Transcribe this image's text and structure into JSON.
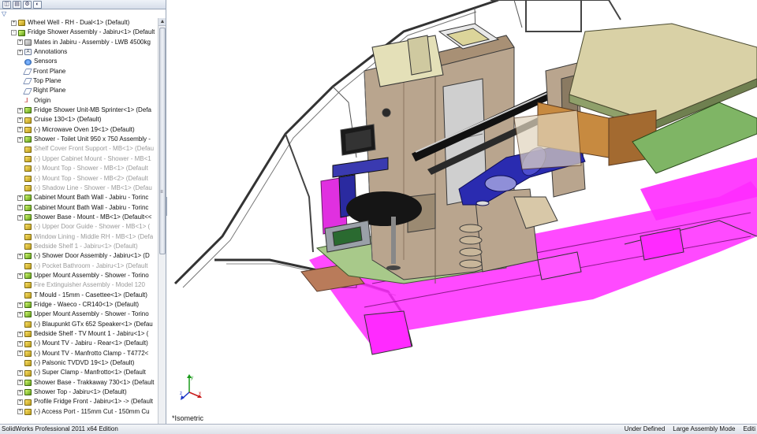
{
  "tree": {
    "filter_glyph": "▽",
    "tabs": [
      "feature-manager",
      "property-manager",
      "configuration-manager",
      "appearance-manager"
    ],
    "items": [
      {
        "label": "Wheel Well - RH - Dual<1> (Default)",
        "indent": 1,
        "expander": "+",
        "icon": "part",
        "suppressed": false
      },
      {
        "label": "Fridge Shower Assembly - Jabiru<1> (Default",
        "indent": 1,
        "expander": "-",
        "icon": "asm",
        "suppressed": false
      },
      {
        "label": "Mates in Jabiru - Assembly - LWB 4500kg",
        "indent": 2,
        "expander": "+",
        "icon": "mates",
        "suppressed": false
      },
      {
        "label": "Annotations",
        "indent": 2,
        "expander": "+",
        "icon": "annot",
        "suppressed": false
      },
      {
        "label": "Sensors",
        "indent": 2,
        "expander": "",
        "icon": "sensor",
        "suppressed": false
      },
      {
        "label": "Front Plane",
        "indent": 2,
        "expander": "",
        "icon": "plane",
        "suppressed": false
      },
      {
        "label": "Top Plane",
        "indent": 2,
        "expander": "",
        "icon": "plane",
        "suppressed": false
      },
      {
        "label": "Right Plane",
        "indent": 2,
        "expander": "",
        "icon": "plane",
        "suppressed": false
      },
      {
        "label": "Origin",
        "indent": 2,
        "expander": "",
        "icon": "origin",
        "suppressed": false
      },
      {
        "label": "Fridge Shower Unit-MB Sprinter<1> (Defa",
        "indent": 2,
        "expander": "+",
        "icon": "asm",
        "suppressed": false
      },
      {
        "label": "Cruise 130<1> (Default)",
        "indent": 2,
        "expander": "+",
        "icon": "part",
        "suppressed": false
      },
      {
        "label": "(-) Microwave Oven 19<1> (Default)",
        "indent": 2,
        "expander": "+",
        "icon": "part",
        "suppressed": false
      },
      {
        "label": "Shower - Toilet Unit 950 x 750 Assembly -",
        "indent": 2,
        "expander": "+",
        "icon": "asm",
        "suppressed": false
      },
      {
        "label": "Shelf Cover Front Support - MB<1> (Defau",
        "indent": 2,
        "expander": "",
        "icon": "part",
        "suppressed": true
      },
      {
        "label": "(-) Upper Cabinet Mount - Shower - MB<1",
        "indent": 2,
        "expander": "",
        "icon": "part",
        "suppressed": true
      },
      {
        "label": "(-) Mount Top - Shower - MB<1> (Default",
        "indent": 2,
        "expander": "",
        "icon": "part",
        "suppressed": true
      },
      {
        "label": "(-) Mount Top - Shower - MB<2> (Default",
        "indent": 2,
        "expander": "",
        "icon": "part",
        "suppressed": true
      },
      {
        "label": "(-) Shadow Line - Shower - MB<1> (Defau",
        "indent": 2,
        "expander": "",
        "icon": "part",
        "suppressed": true
      },
      {
        "label": "Cabinet Mount Bath Wall - Jabiru - Torinc",
        "indent": 2,
        "expander": "+",
        "icon": "asm",
        "suppressed": false
      },
      {
        "label": "Cabinet Mount Bath Wall - Jabiru - Torinc",
        "indent": 2,
        "expander": "+",
        "icon": "asm",
        "suppressed": false
      },
      {
        "label": "Shower Base - Mount - MB<1> (Default<<",
        "indent": 2,
        "expander": "+",
        "icon": "asm",
        "suppressed": false
      },
      {
        "label": "(-) Upper Door Guide - Shower - MB<1> (",
        "indent": 2,
        "expander": "",
        "icon": "part",
        "suppressed": true
      },
      {
        "label": "Window Lining - Middle RH - MB<1> (Defa",
        "indent": 2,
        "expander": "",
        "icon": "part",
        "suppressed": true
      },
      {
        "label": "Bedside Shelf 1 - Jabiru<1> (Default)",
        "indent": 2,
        "expander": "",
        "icon": "part",
        "suppressed": true
      },
      {
        "label": "(-) Shower Door Assembly - Jabiru<1> (D",
        "indent": 2,
        "expander": "+",
        "icon": "asm",
        "suppressed": false
      },
      {
        "label": "(-) Pocket Bathroom - Jabiru<1> (Default",
        "indent": 2,
        "expander": "",
        "icon": "part",
        "suppressed": true
      },
      {
        "label": "Upper Mount Assembly - Shower - Torino",
        "indent": 2,
        "expander": "+",
        "icon": "asm",
        "suppressed": false
      },
      {
        "label": "Fire Extinguisher Assembly - Model 120",
        "indent": 2,
        "expander": "",
        "icon": "part",
        "suppressed": true
      },
      {
        "label": "T Mould - 15mm - Casettee<1> (Default)",
        "indent": 2,
        "expander": "",
        "icon": "part",
        "suppressed": false
      },
      {
        "label": "Fridge - Waeco - CR140<1> (Default)",
        "indent": 2,
        "expander": "+",
        "icon": "asm",
        "suppressed": false
      },
      {
        "label": "Upper Mount Assembly - Shower - Torino",
        "indent": 2,
        "expander": "+",
        "icon": "asm",
        "suppressed": false
      },
      {
        "label": "(-) Blaupunkt GTx 652 Speaker<1> (Defau",
        "indent": 2,
        "expander": "",
        "icon": "part",
        "suppressed": false
      },
      {
        "label": "Bedside Shelf - TV Mount 1 - Jabiru<1> (",
        "indent": 2,
        "expander": "+",
        "icon": "part",
        "suppressed": false
      },
      {
        "label": "(-) Mount TV - Jabiru - Rear<1> (Default)",
        "indent": 2,
        "expander": "+",
        "icon": "part",
        "suppressed": false
      },
      {
        "label": "(-) Mount TV - Manfrotto Clamp - T4772<",
        "indent": 2,
        "expander": "+",
        "icon": "part",
        "suppressed": false
      },
      {
        "label": "(-) Palsonic TVDVD 19<1> (Default)",
        "indent": 2,
        "expander": "",
        "icon": "part",
        "suppressed": false
      },
      {
        "label": "(-) Super Clamp - Manfrotto<1> (Default",
        "indent": 2,
        "expander": "+",
        "icon": "part",
        "suppressed": false
      },
      {
        "label": "Shower Base - Trakkaway 730<1> (Default",
        "indent": 2,
        "expander": "+",
        "icon": "asm",
        "suppressed": false
      },
      {
        "label": "Shower Top - Jabiru<1> (Default)",
        "indent": 2,
        "expander": "+",
        "icon": "asm",
        "suppressed": false
      },
      {
        "label": "Profile Fridge Front - Jabiru<1> -> (Default",
        "indent": 2,
        "expander": "+",
        "icon": "part",
        "suppressed": false
      },
      {
        "label": "(-) Access Port - 115mm Cut - 150mm Cu",
        "indent": 2,
        "expander": "+",
        "icon": "part",
        "suppressed": false
      }
    ]
  },
  "viewport": {
    "view_label": "*Isometric",
    "triad_axes": [
      "y",
      "x",
      "z"
    ],
    "colors": {
      "cabinet": "#b9a58e",
      "wall": "#c8c8c8",
      "floor_green": "#a8c98a",
      "magenta": "#ff2aff",
      "blue_shelf": "#2a2bb0",
      "bed_top": "#d9d1a6",
      "brown_board": "#b97b5a"
    }
  },
  "status": {
    "app_title": "SolidWorks Professional 2011 x64 Edition",
    "definition": "Under Defined",
    "mode": "Large Assembly Mode",
    "editing": "Editi"
  }
}
